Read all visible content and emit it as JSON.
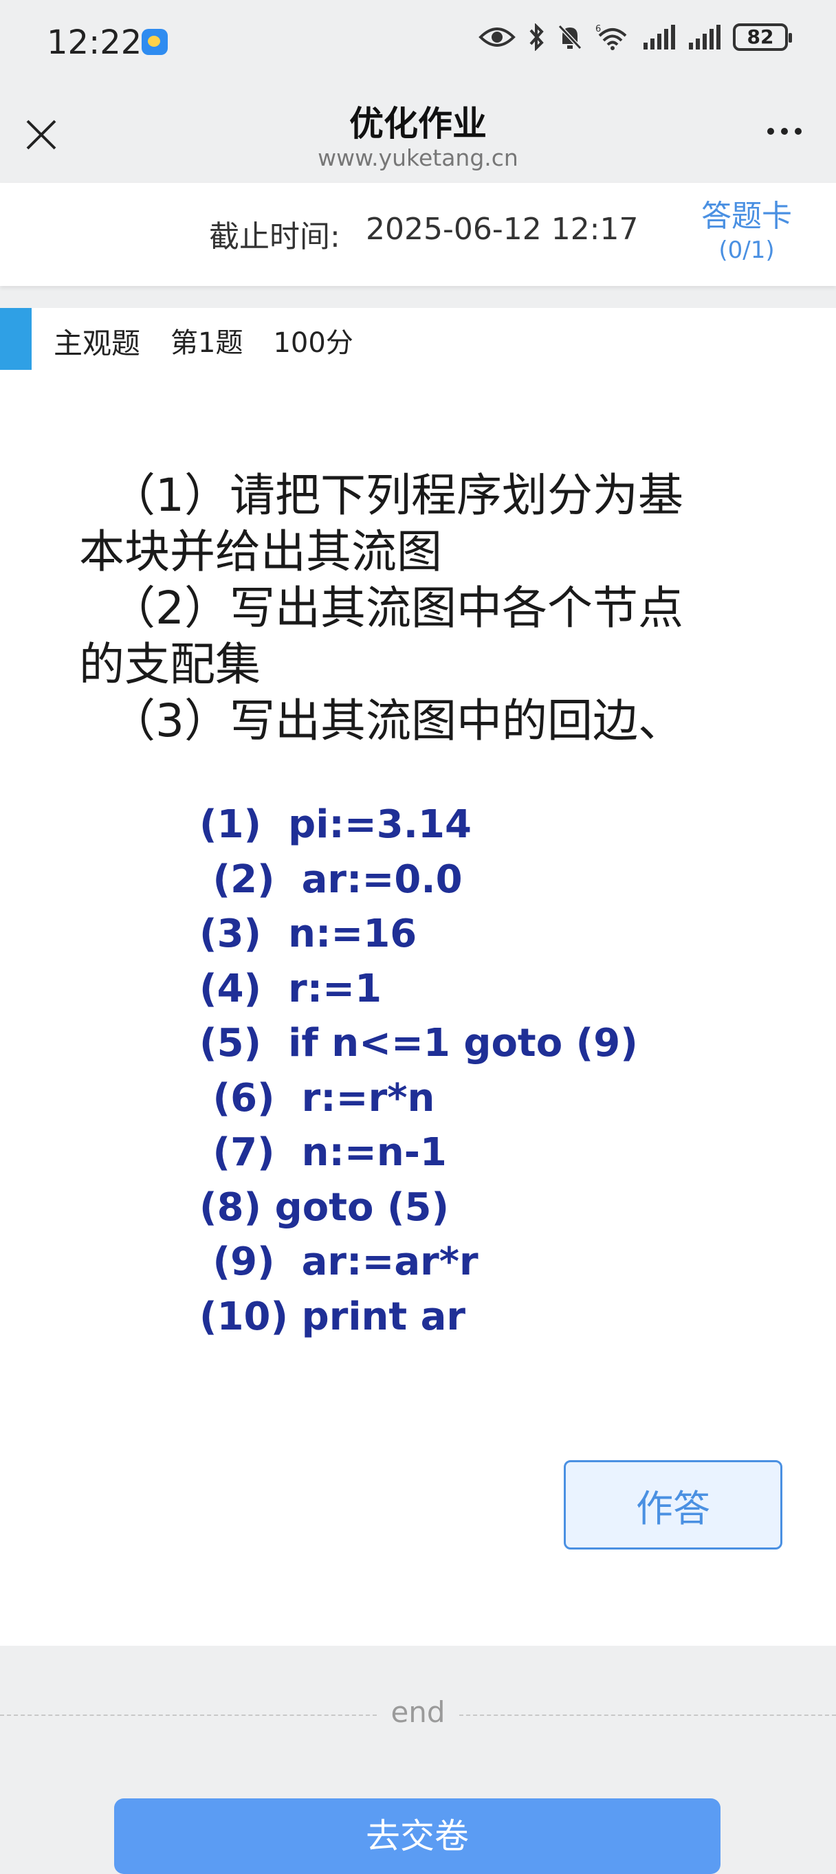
{
  "status_bar": {
    "time": "12:22",
    "battery": "82",
    "network_label": "6"
  },
  "nav": {
    "title": "优化作业",
    "url": "www.yuketang.cn"
  },
  "deadline": {
    "label": "截止时间:",
    "value": "2025-06-12 12:17",
    "card_title": "答题卡",
    "card_count": "(0/1)"
  },
  "question": {
    "type": "主观题",
    "number": "第1题",
    "score": "100分",
    "text_lines": [
      "（1）请把下列程序划分为基",
      "本块并给出其流图",
      "（2）写出其流图中各个节点",
      "的支配集",
      "（3）写出其流图中的回边、"
    ],
    "code_lines": [
      "(1)  pi:=3.14",
      " (2)  ar:=0.0",
      "(3)  n:=16",
      "(4)  r:=1",
      "(5)  if n<=1 goto (9)",
      " (6)  r:=r*n",
      " (7)  n:=n-1",
      "(8) goto (5)",
      " (9)  ar:=ar*r",
      "(10) print ar"
    ],
    "answer_button": "作答"
  },
  "footer": {
    "end_text": "end",
    "submit_button": "去交卷"
  },
  "colors": {
    "accent": "#4a90e2",
    "question_bar": "#2fa0e5",
    "code_text": "#1f2f96",
    "submit_bg": "#5b9cf3"
  }
}
